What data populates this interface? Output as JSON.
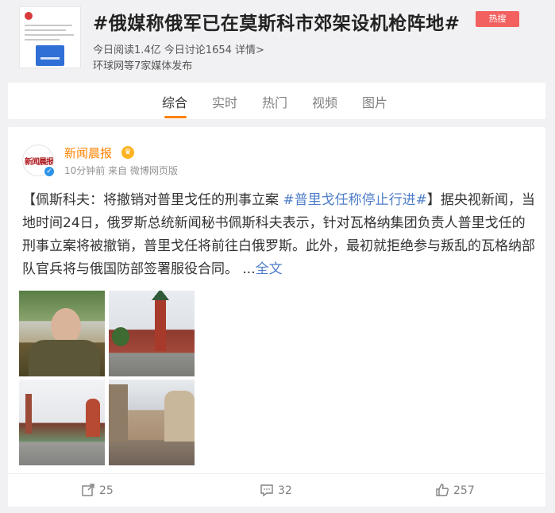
{
  "topic": {
    "title": "#俄媒称俄军已在莫斯科市郊架设机枪阵地#",
    "hot_badge": "热搜",
    "stats": "今日阅读1.4亿  今日讨论1654  详情>",
    "media": "环球网等7家媒体发布"
  },
  "tabs": [
    {
      "label": "综合",
      "active": true
    },
    {
      "label": "实时",
      "active": false
    },
    {
      "label": "热门",
      "active": false
    },
    {
      "label": "视频",
      "active": false
    },
    {
      "label": "图片",
      "active": false
    }
  ],
  "post": {
    "author": "新闻晨报",
    "avatar_text": "新闻晨报",
    "meta": "10分钟前 来自 微博网页版",
    "text_lead": "【佩斯科夫：将撤销对普里戈任的刑事立案 ",
    "hashtag": "#普里戈任称停止行进#",
    "text_body": "】据央视新闻，当地时间24日，俄罗斯总统新闻秘书佩斯科夫表示，针对瓦格纳集团负责人普里戈任的刑事立案将被撤销，普里戈任将前往白俄罗斯。此外，最初就拒绝参与叛乱的瓦格纳部队官兵将与俄国防部签署服役合同。 ...",
    "more_label": "全文",
    "photos": [
      "photo-1",
      "photo-2",
      "photo-3",
      "photo-4"
    ]
  },
  "actions": {
    "repost": "25",
    "comment": "32",
    "like": "257"
  },
  "colors": {
    "accent": "#ff8200",
    "hot_badge": "#f2605f",
    "link": "#4f7ec9"
  }
}
